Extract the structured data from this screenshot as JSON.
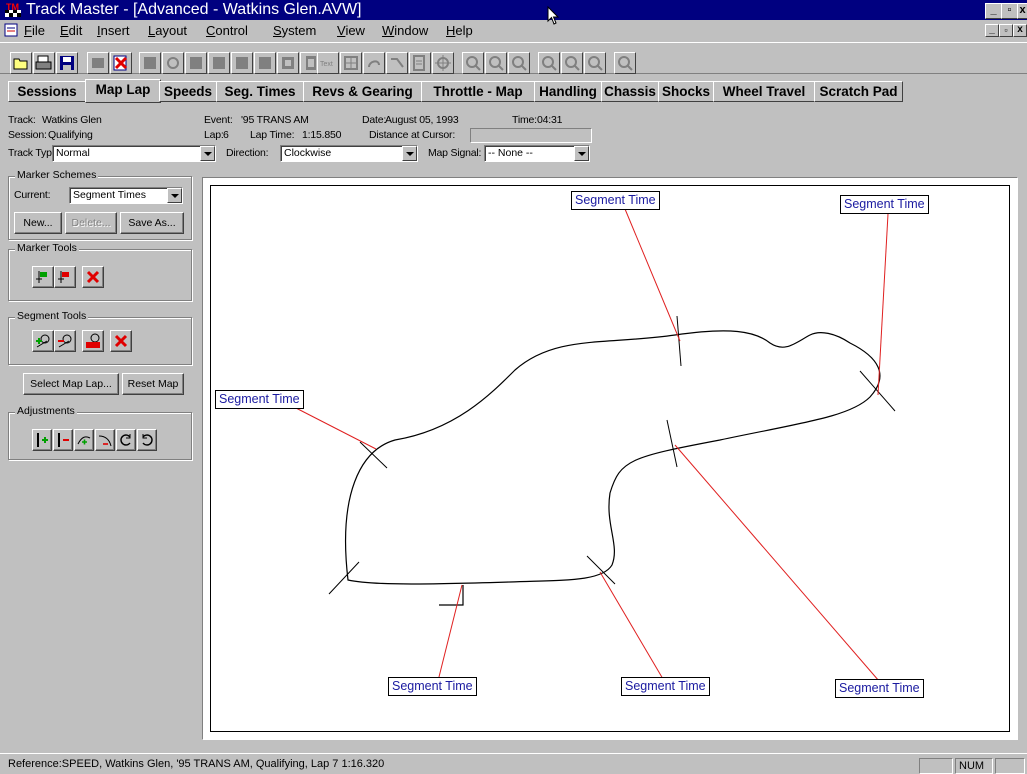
{
  "window": {
    "title": "Track Master - [Advanced - Watkins Glen.AVW]"
  },
  "menu": [
    "File",
    "Edit",
    "Insert",
    "Layout",
    "Control",
    "System",
    "View",
    "Window",
    "Help"
  ],
  "toolbar": {
    "icons": [
      "open-icon",
      "print-icon",
      "save-icon",
      "blank-icon",
      "delete-icon",
      "square-icon",
      "square-icon",
      "square-icon",
      "square-icon",
      "square-icon",
      "square-icon",
      "square-icon",
      "text-icon",
      "grid-icon",
      "lap-icon",
      "arrow-icon",
      "export-icon",
      "crosshair-icon",
      "zoom-icon",
      "zoom-icon",
      "zoom-icon",
      "zoom-icon",
      "zoom-icon",
      "zoom-icon",
      "zoom-icon"
    ]
  },
  "tabs": [
    "Sessions",
    "Map Lap",
    "Speeds",
    "Seg. Times",
    "Revs & Gearing",
    "Throttle - Map",
    "Handling",
    "Chassis",
    "Shocks",
    "Wheel Travel",
    "Scratch Pad"
  ],
  "active_tab": "Map Lap",
  "info": {
    "track_label": "Track:",
    "track": "Watkins Glen",
    "session_label": "Session:",
    "session": "Qualifying",
    "event_label": "Event:",
    "event": "'95 TRANS AM",
    "date_label": "Date:",
    "date": "August 05, 1993",
    "time_label": "Time:",
    "time": "04:31",
    "lap_label": "Lap:",
    "lap": "6",
    "laptime_label": "Lap Time:",
    "laptime": "1:15.850",
    "distance_label": "Distance at Cursor:",
    "track_type_label": "Track Type:",
    "track_type": "Normal",
    "direction_label": "Direction:",
    "direction": "Clockwise",
    "map_signal_label": "Map Signal:",
    "map_signal": "-- None --"
  },
  "marker_schemes": {
    "title": "Marker Schemes",
    "current_label": "Current:",
    "current": "Segment Times",
    "new": "New...",
    "delete": "Delete...",
    "save_as": "Save As..."
  },
  "marker_tools": {
    "title": "Marker Tools"
  },
  "segment_tools": {
    "title": "Segment Tools"
  },
  "buttons": {
    "select_map_lap": "Select Map Lap...",
    "reset_map": "Reset Map"
  },
  "adjustments": {
    "title": "Adjustments"
  },
  "segment_label": "Segment Time",
  "status": {
    "text": "Reference:SPEED, Watkins Glen, '95 TRANS AM, Qualifying, Lap 7 1:16.320",
    "num": "NUM"
  },
  "colors": {
    "title_bar": "#000080",
    "label_text": "#1a1aa0",
    "leader_line": "#e02020",
    "face": "#c0c0c0"
  }
}
